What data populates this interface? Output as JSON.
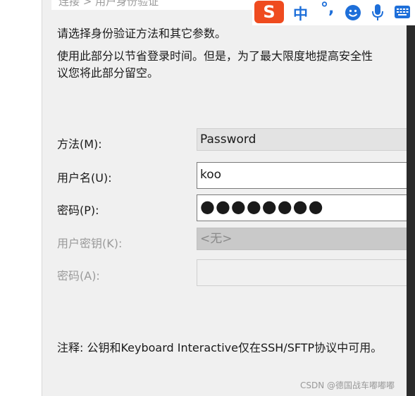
{
  "header": {
    "breadcrumb": "连接 > 用户身份验证"
  },
  "ime": {
    "logo": "S",
    "mode": "中",
    "punct": "°,"
  },
  "intro": {
    "line1": "请选择身份验证方法和其它参数。",
    "line2": "使用此部分以节省登录时间。但是，为了最大限度地提高安全性",
    "line3": "议您将此部分留空。"
  },
  "form": {
    "method_label": "方法(M):",
    "method_value": "Password",
    "username_label": "用户名(U):",
    "username_value": "koo",
    "password_label": "密码(P):",
    "password_value": "●●●●●●●●",
    "userkey_label": "用户密钥(K):",
    "userkey_value": "<无>",
    "passphrase_label": "密码(A):",
    "passphrase_value": ""
  },
  "note": "注释: 公钥和Keyboard Interactive仅在SSH/SFTP协议中可用。",
  "watermark": "CSDN @德国战车嘟嘟嘟"
}
